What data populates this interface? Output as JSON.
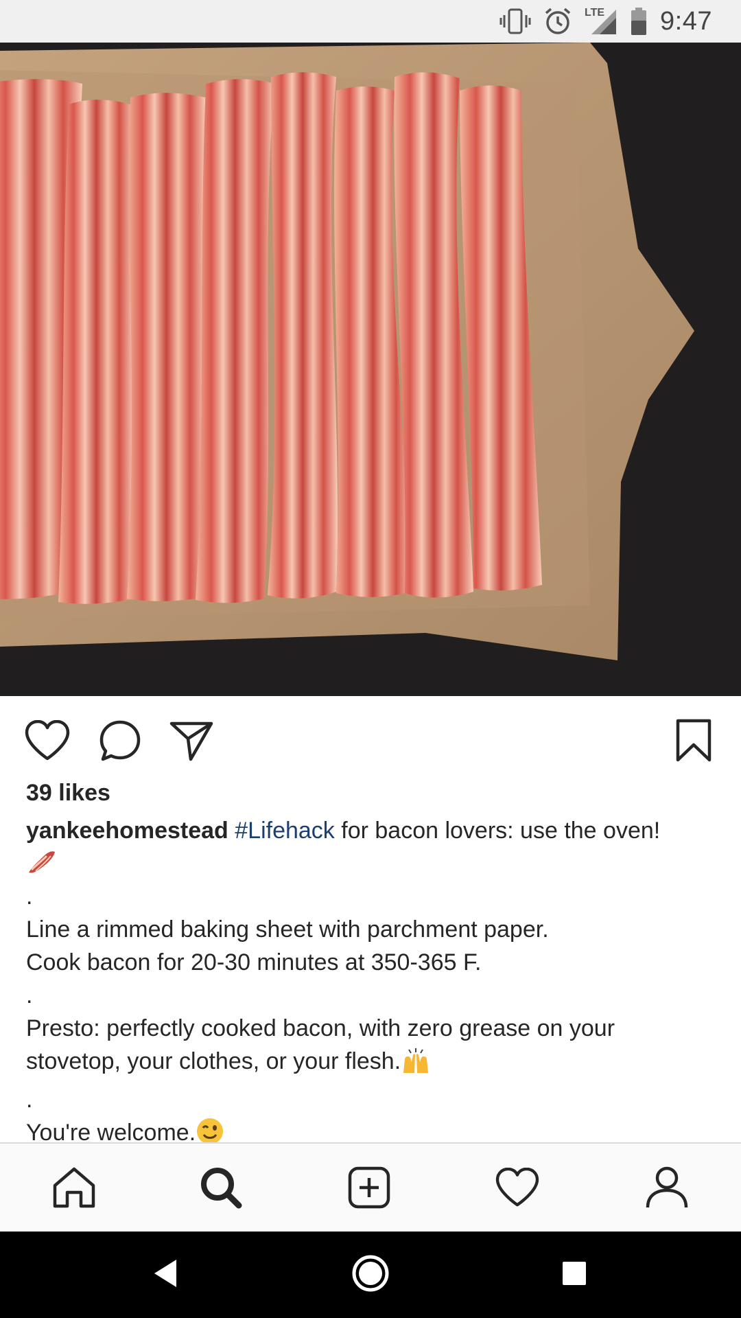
{
  "status_bar": {
    "time": "9:47",
    "network_label": "LTE",
    "icons": [
      "vibrate-icon",
      "alarm-icon",
      "lte-signal-icon",
      "battery-icon"
    ]
  },
  "post": {
    "image_alt": "Raw bacon strips on parchment-lined baking sheet",
    "likes": "39 likes",
    "username": "yankeehomestead",
    "hashtag": "#Lifehack",
    "caption_first": " for bacon lovers: use the oven!",
    "dot_1": ".",
    "line_1": "Line a rimmed baking sheet with parchment paper.",
    "line_2": "Cook bacon for 20-30 minutes at 350-365 F.",
    "dot_2": ".",
    "line_3": "Presto: perfectly cooked bacon, with zero grease on your",
    "line_4": "stovetop, your clothes, or your flesh.",
    "dot_3": ".",
    "line_5": "You're welcome.",
    "emojis": [
      "bacon-emoji",
      "raising-hands-emoji",
      "winking-face-emoji"
    ]
  },
  "actions": [
    "heart-icon",
    "comment-icon",
    "share-icon",
    "bookmark-icon"
  ],
  "bottom_nav": [
    "home-icon",
    "search-icon",
    "add-post-icon",
    "activity-heart-icon",
    "profile-icon"
  ],
  "android_nav": [
    "back-icon",
    "home-circle-icon",
    "recents-icon"
  ]
}
